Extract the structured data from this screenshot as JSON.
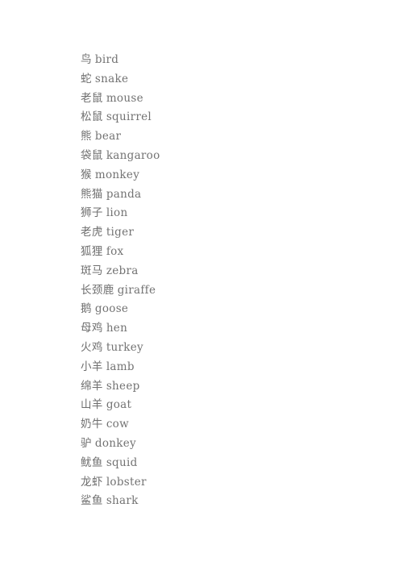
{
  "document": {
    "background_color": "#ffffff",
    "text_color": "#6f6f6f",
    "entries": [
      {
        "zh": "鸟",
        "en": "bird"
      },
      {
        "zh": "蛇",
        "en": "snake"
      },
      {
        "zh": "老鼠",
        "en": "mouse"
      },
      {
        "zh": "松鼠",
        "en": "squirrel"
      },
      {
        "zh": "熊",
        "en": "bear"
      },
      {
        "zh": "袋鼠",
        "en": "kangaroo"
      },
      {
        "zh": "猴",
        "en": "monkey"
      },
      {
        "zh": "熊猫",
        "en": "panda"
      },
      {
        "zh": "狮子",
        "en": "lion"
      },
      {
        "zh": "老虎",
        "en": "tiger"
      },
      {
        "zh": "狐狸",
        "en": "fox"
      },
      {
        "zh": "斑马",
        "en": "zebra"
      },
      {
        "zh": "长颈鹿",
        "en": "giraffe"
      },
      {
        "zh": "鹅",
        "en": "goose"
      },
      {
        "zh": "母鸡",
        "en": "hen"
      },
      {
        "zh": "火鸡",
        "en": "turkey"
      },
      {
        "zh": "小羊",
        "en": "lamb"
      },
      {
        "zh": "绵羊",
        "en": "sheep"
      },
      {
        "zh": "山羊",
        "en": "goat"
      },
      {
        "zh": "奶牛",
        "en": "cow"
      },
      {
        "zh": "驴",
        "en": "donkey"
      },
      {
        "zh": "鱿鱼",
        "en": "squid"
      },
      {
        "zh": "龙虾",
        "en": "lobster"
      },
      {
        "zh": "鲨鱼",
        "en": "shark"
      }
    ]
  }
}
